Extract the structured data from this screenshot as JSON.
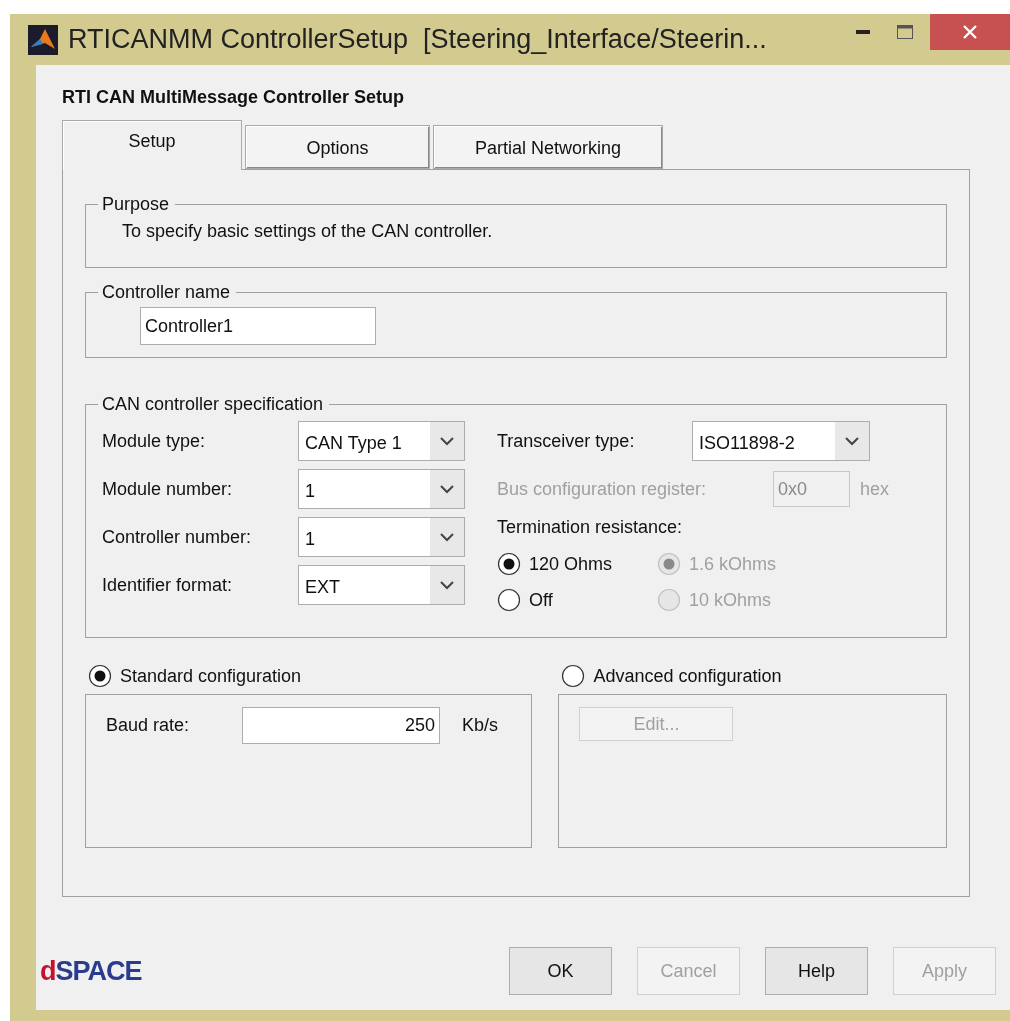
{
  "window": {
    "title": "RTICANMM ControllerSetup  [Steering_Interface/Steerin..."
  },
  "heading": "RTI CAN MultiMessage Controller Setup",
  "tabs": [
    {
      "label": "Setup",
      "selected": true
    },
    {
      "label": "Options",
      "selected": false
    },
    {
      "label": "Partial Networking",
      "selected": false
    }
  ],
  "purpose": {
    "legend": "Purpose",
    "text": "To specify basic settings of the CAN controller."
  },
  "controller_name": {
    "legend": "Controller name",
    "value": "Controller1"
  },
  "can_spec": {
    "legend": "CAN controller specification",
    "left_fields": [
      {
        "label": "Module type:",
        "value": "CAN Type 1"
      },
      {
        "label": "Module number:",
        "value": "1"
      },
      {
        "label": "Controller number:",
        "value": "1"
      },
      {
        "label": "Identifier format:",
        "value": "EXT"
      }
    ],
    "transceiver": {
      "label": "Transceiver type:",
      "value": "ISO11898-2"
    },
    "bus_config": {
      "label": "Bus configuration register:",
      "value": "0x0",
      "unit": "hex",
      "disabled": true
    },
    "termination": {
      "label": "Termination resistance:",
      "options": [
        {
          "label": "120 Ohms",
          "selected": true,
          "disabled": false
        },
        {
          "label": "1.6 kOhms",
          "selected": true,
          "disabled": true
        },
        {
          "label": "Off",
          "selected": false,
          "disabled": false
        },
        {
          "label": "10 kOhms",
          "selected": false,
          "disabled": true
        }
      ]
    }
  },
  "configurations": [
    {
      "kind": "baud",
      "label": "Standard configuration",
      "selected": true,
      "field_label": "Baud rate:",
      "value": "250",
      "unit": "Kb/s"
    },
    {
      "kind": "edit",
      "label": "Advanced configuration",
      "selected": false,
      "button": {
        "label": "Edit...",
        "disabled": true
      }
    }
  ],
  "buttons": [
    {
      "label": "OK",
      "disabled": false
    },
    {
      "label": "Cancel",
      "disabled": true
    },
    {
      "label": "Help",
      "disabled": false
    },
    {
      "label": "Apply",
      "disabled": true
    }
  ],
  "logo": "dSPACE"
}
